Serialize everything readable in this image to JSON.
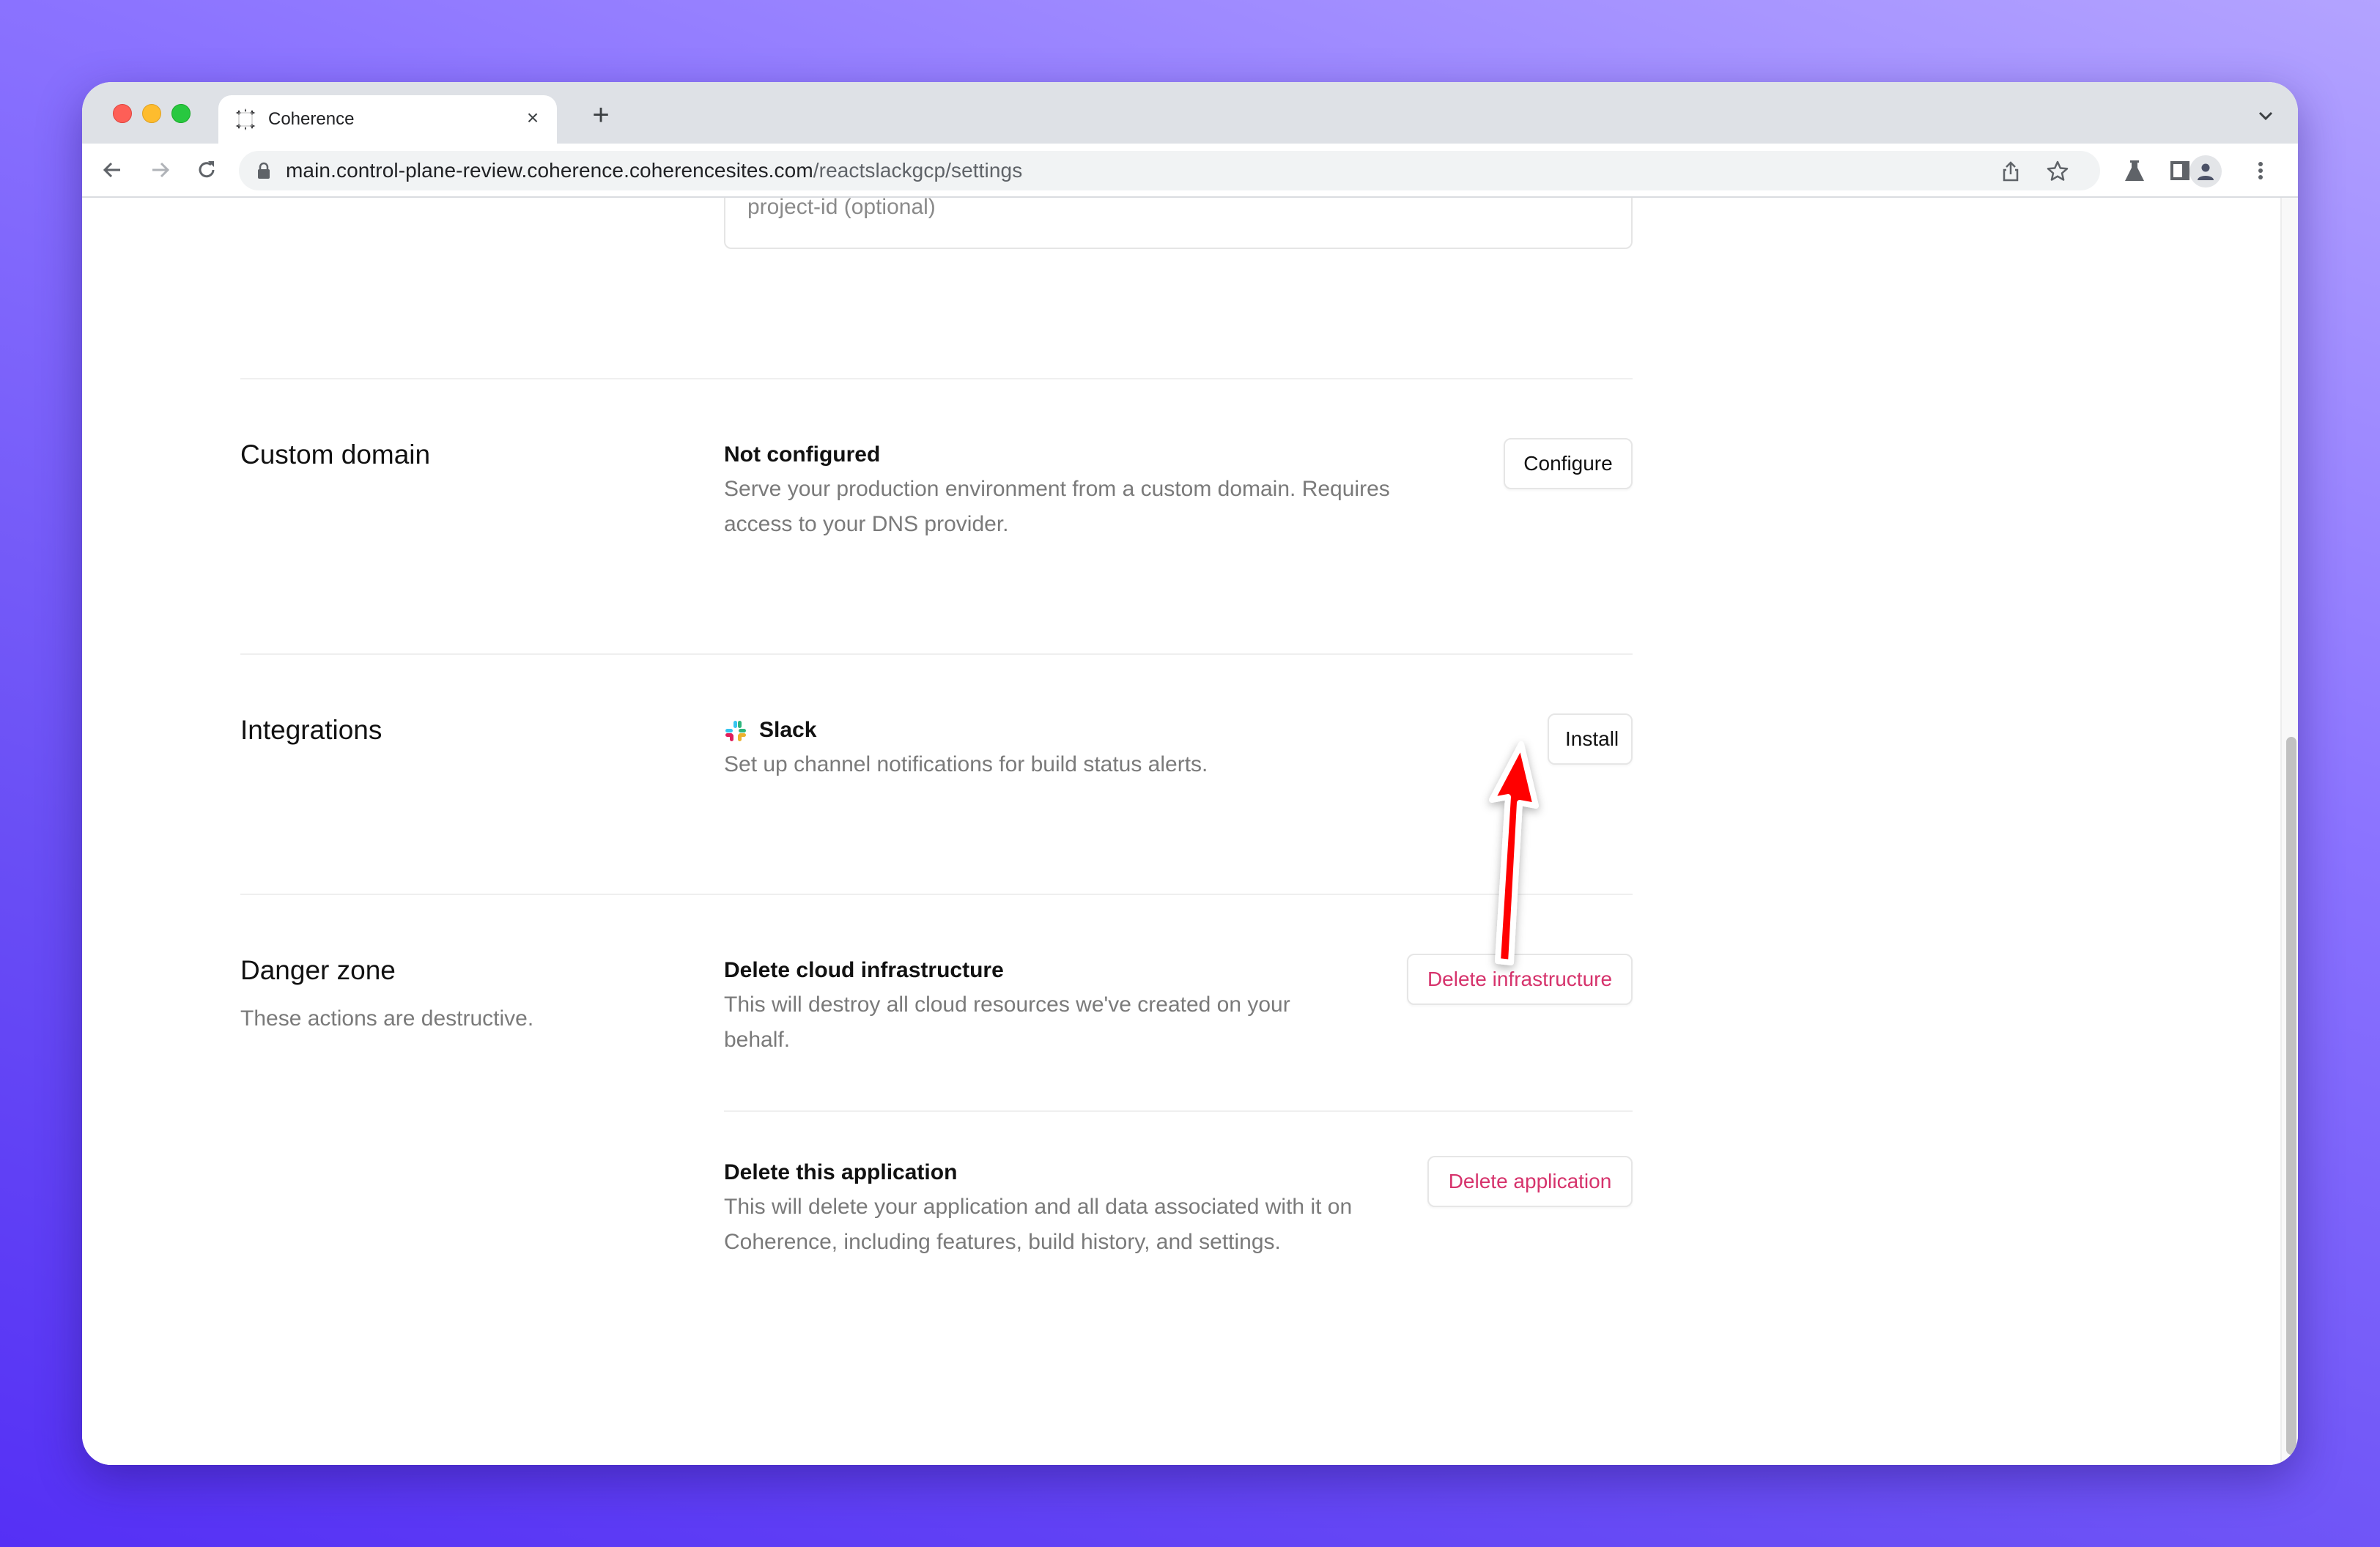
{
  "browser": {
    "tab": {
      "title": "Coherence",
      "favicon": "coherence-logo-icon",
      "close_label": "×"
    },
    "new_tab_label": "+",
    "url": {
      "host": "main.control-plane-review.coherence.coherencesites.com",
      "path": "/reactslackgcp/settings"
    },
    "toolbar_icons": [
      "back-icon",
      "forward-icon",
      "reload-icon",
      "lock-icon",
      "share-icon",
      "bookmark-star-icon",
      "labs-flask-icon",
      "side-panel-icon",
      "profile-icon",
      "menu-kebab-icon"
    ]
  },
  "page": {
    "project_id_input": {
      "placeholder": "project-id (optional)",
      "value": ""
    },
    "sections": {
      "custom_domain": {
        "title": "Custom domain",
        "status_title": "Not configured",
        "description": "Serve your production environment from a custom domain. Requires access to your DNS provider.",
        "button_label": "Configure"
      },
      "integrations": {
        "title": "Integrations",
        "item_name": "Slack",
        "item_icon": "slack-logo-icon",
        "description": "Set up channel notifications for build status alerts.",
        "button_label": "Install"
      },
      "danger_zone": {
        "title": "Danger zone",
        "subtitle": "These actions are destructive.",
        "items": [
          {
            "title": "Delete cloud infrastructure",
            "description": "This will destroy all cloud resources we've created on your behalf.",
            "button_label": "Delete infrastructure"
          },
          {
            "title": "Delete this application",
            "description": "This will delete your application and all data associated with it on Coherence, including features, build history, and settings.",
            "button_label": "Delete application"
          }
        ]
      }
    }
  },
  "annotation": {
    "type": "arrow",
    "points_to": "Install",
    "color": "#ff0000"
  },
  "colors": {
    "danger": "#d6336c",
    "annotation": "#ff0000",
    "tab_strip": "#dee1e6"
  }
}
